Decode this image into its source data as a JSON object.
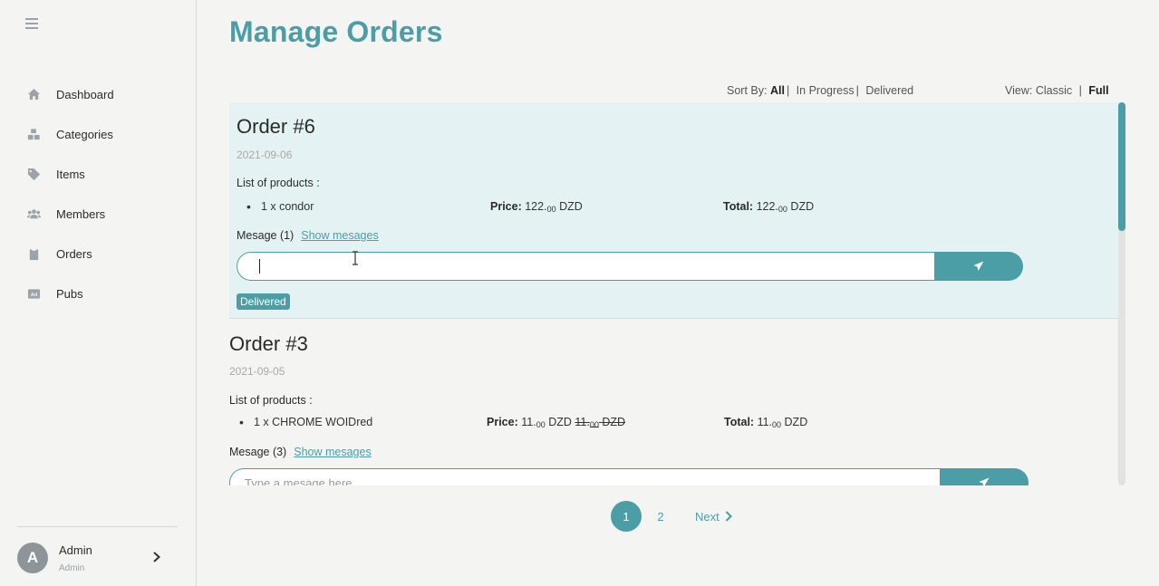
{
  "sidebar": {
    "items": [
      {
        "label": "Dashboard",
        "icon": "home-icon"
      },
      {
        "label": "Categories",
        "icon": "boxes-icon"
      },
      {
        "label": "Items",
        "icon": "tag-icon"
      },
      {
        "label": "Members",
        "icon": "users-icon"
      },
      {
        "label": "Orders",
        "icon": "clipboard-icon"
      },
      {
        "label": "Pubs",
        "icon": "ad-icon"
      }
    ],
    "user": {
      "initial": "A",
      "name": "Admin",
      "role": "Admin"
    }
  },
  "header": {
    "title": "Manage Orders"
  },
  "sort": {
    "label": "Sort By:",
    "options": [
      "All",
      "In Progress",
      "Delivered"
    ],
    "active": "All"
  },
  "view": {
    "label": "View:",
    "options": [
      "Classic",
      "Full"
    ],
    "active": "Full"
  },
  "orders": [
    {
      "title": "Order #6",
      "date": "2021-09-06",
      "list_heading": "List of products :",
      "product": "1 x condor",
      "price_label": "Price:",
      "price_int": "122.",
      "price_dec": "00",
      "currency": "DZD",
      "total_label": "Total:",
      "total_int": "122.",
      "total_dec": "00",
      "message_label": "Mesage (1)",
      "show_messages": "Show mesages",
      "input_value": "",
      "status": "Delivered"
    },
    {
      "title": "Order #3",
      "date": "2021-09-05",
      "list_heading": "List of products :",
      "product": "1 x CHROME WOIDred",
      "price_label": "Price:",
      "price_int": "11.",
      "price_dec": "00",
      "currency": "DZD",
      "old_price_int": "11.",
      "old_price_dec": "00",
      "old_currency": "DZD",
      "total_label": "Total:",
      "total_int": "11.",
      "total_dec": "00",
      "message_label": "Mesage (3)",
      "show_messages": "Show mesages",
      "input_placeholder": "Type a mesage here"
    }
  ],
  "pagination": {
    "pages": [
      "1",
      "2"
    ],
    "active": "1",
    "next": "Next"
  },
  "colors": {
    "accent": "#4b9ea6",
    "highlight_row": "#e5f2f4",
    "background": "#f4f4f3"
  }
}
